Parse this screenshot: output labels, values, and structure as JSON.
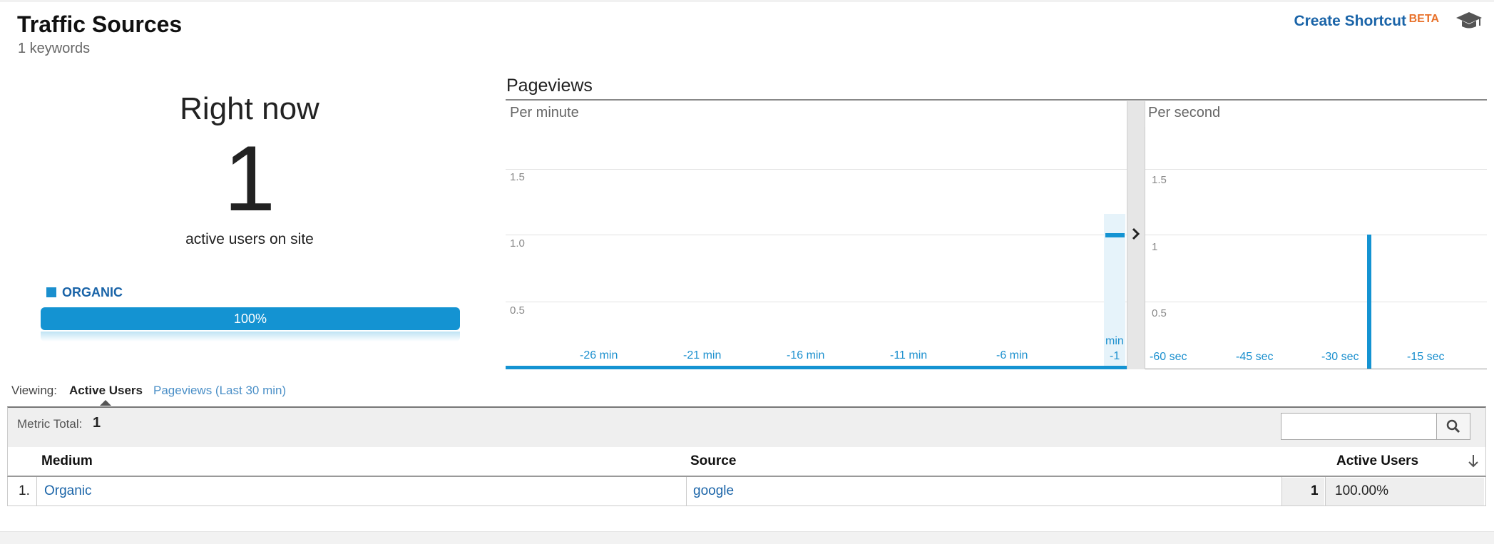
{
  "header": {
    "title": "Traffic Sources",
    "subtitle": "1 keywords",
    "create_shortcut": "Create Shortcut",
    "beta": "BETA",
    "help_icon": "graduation-cap-icon"
  },
  "right_now": {
    "title": "Right now",
    "count": "1",
    "label": "active users on site",
    "legend_label": "ORGANIC",
    "bar_percent": "100%",
    "bar_fraction": 1.0,
    "colors": {
      "bar": "#1493d2",
      "legend": "#1a8fce"
    }
  },
  "pageviews": {
    "title": "Pageviews",
    "per_minute": {
      "label": "Per minute",
      "y_ticks": [
        "1.5",
        "1.0",
        "0.5"
      ],
      "x_ticks": [
        "-26 min",
        "-21 min",
        "-16 min",
        "-11 min",
        "-6 min"
      ],
      "last_tick_top": "min",
      "last_tick_bottom": "-1"
    },
    "per_second": {
      "label": "Per second",
      "y_ticks": [
        "1.5",
        "1",
        "0.5"
      ],
      "x_ticks": [
        "-60 sec",
        "-45 sec",
        "-30 sec",
        "-15 sec"
      ]
    }
  },
  "chart_data": [
    {
      "type": "bar",
      "title": "Per minute",
      "x": [
        -30,
        -29,
        -28,
        -27,
        -26,
        -25,
        -24,
        -23,
        -22,
        -21,
        -20,
        -19,
        -18,
        -17,
        -16,
        -15,
        -14,
        -13,
        -12,
        -11,
        -10,
        -9,
        -8,
        -7,
        -6,
        -5,
        -4,
        -3,
        -2,
        -1
      ],
      "values": [
        0,
        0,
        0,
        0,
        0,
        0,
        0,
        0,
        0,
        0,
        0,
        0,
        0,
        0,
        0,
        0,
        0,
        0,
        0,
        0,
        0,
        0,
        0,
        0,
        0,
        0,
        0,
        0,
        0,
        1
      ],
      "ylim": [
        0,
        1.9
      ]
    },
    {
      "type": "bar",
      "title": "Per second",
      "x": [
        -21
      ],
      "values": [
        1
      ],
      "ylim": [
        0,
        1.9
      ]
    }
  ],
  "viewing": {
    "label": "Viewing:",
    "active": "Active Users",
    "other": "Pageviews (Last 30 min)"
  },
  "table": {
    "metric_total_label": "Metric Total:",
    "metric_total_value": "1",
    "search_placeholder": "",
    "columns": [
      "Medium",
      "Source",
      "Active Users"
    ],
    "rows": [
      {
        "index": "1.",
        "medium": "Organic",
        "source": "google",
        "active_users": "1",
        "percent": "100.00%"
      }
    ]
  }
}
